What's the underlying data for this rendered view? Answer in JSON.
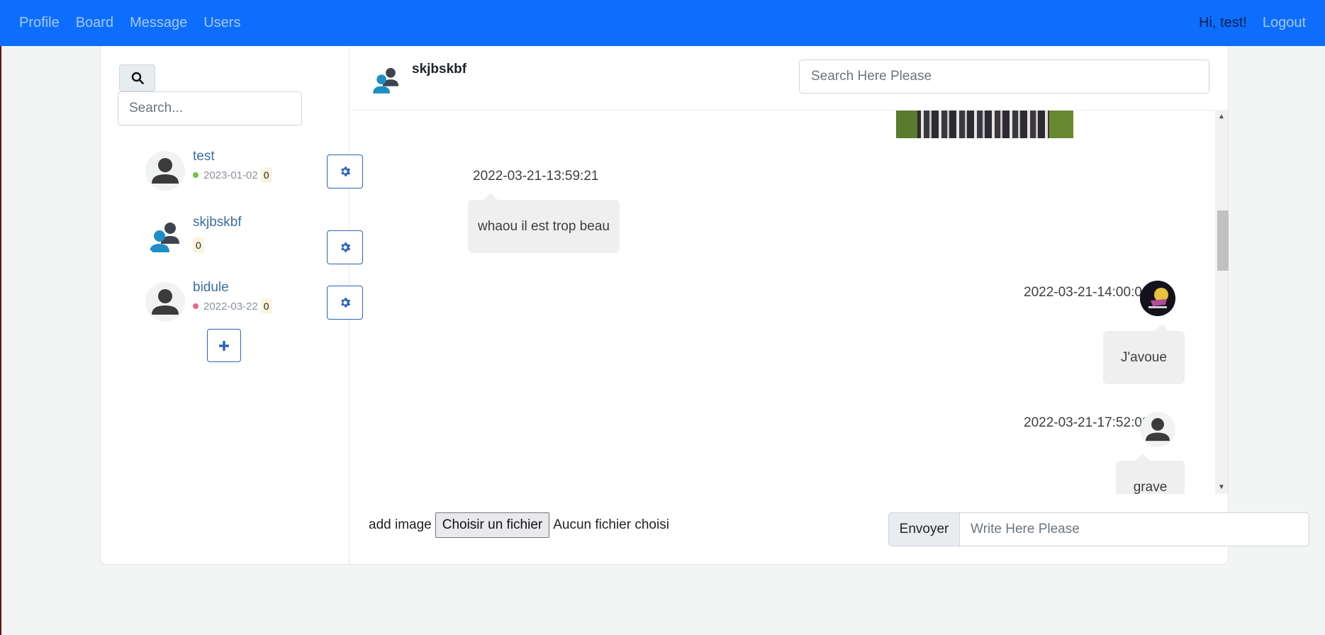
{
  "nav": {
    "links": [
      "Profile",
      "Board",
      "Message",
      "Users"
    ],
    "greeting": "Hi, test!",
    "logout": "Logout"
  },
  "sidebar": {
    "search_placeholder": "Search...",
    "search_icon": "search-icon",
    "contacts": [
      {
        "name": "test",
        "date": "2023-01-02",
        "count": "0",
        "status_color": "#7bc043",
        "avatar": "user-icon"
      },
      {
        "name": "skjbskbf",
        "date": "",
        "count": "0",
        "status_color": "",
        "avatar": "group-icon"
      },
      {
        "name": "bidule",
        "date": "2022-03-22",
        "count": "0",
        "status_color": "#e06c8a",
        "avatar": "user-icon"
      }
    ],
    "settings_icon": "gear-icon",
    "add_icon": "plus-icon"
  },
  "chat": {
    "title": "skjbskbf",
    "search_placeholder": "Search Here Please",
    "messages": [
      {
        "timestamp": "2022-03-21-13:59:21",
        "text": "whaou il est trop beau",
        "side": "left"
      },
      {
        "timestamp": "2022-03-21-14:00:04",
        "text": "J'avoue",
        "side": "right"
      },
      {
        "timestamp": "2022-03-21-17:52:08",
        "text": "grave",
        "side": "right"
      }
    ]
  },
  "composer": {
    "add_image_label": "add image",
    "file_button": "Choisir un fichier",
    "file_status": "Aucun fichier choisi",
    "send_button": "Envoyer",
    "message_placeholder": "Write Here Please"
  },
  "colors": {
    "navbar": "#0d6efd",
    "link": "#3b6ea5",
    "accent_border": "#2c64b8"
  }
}
